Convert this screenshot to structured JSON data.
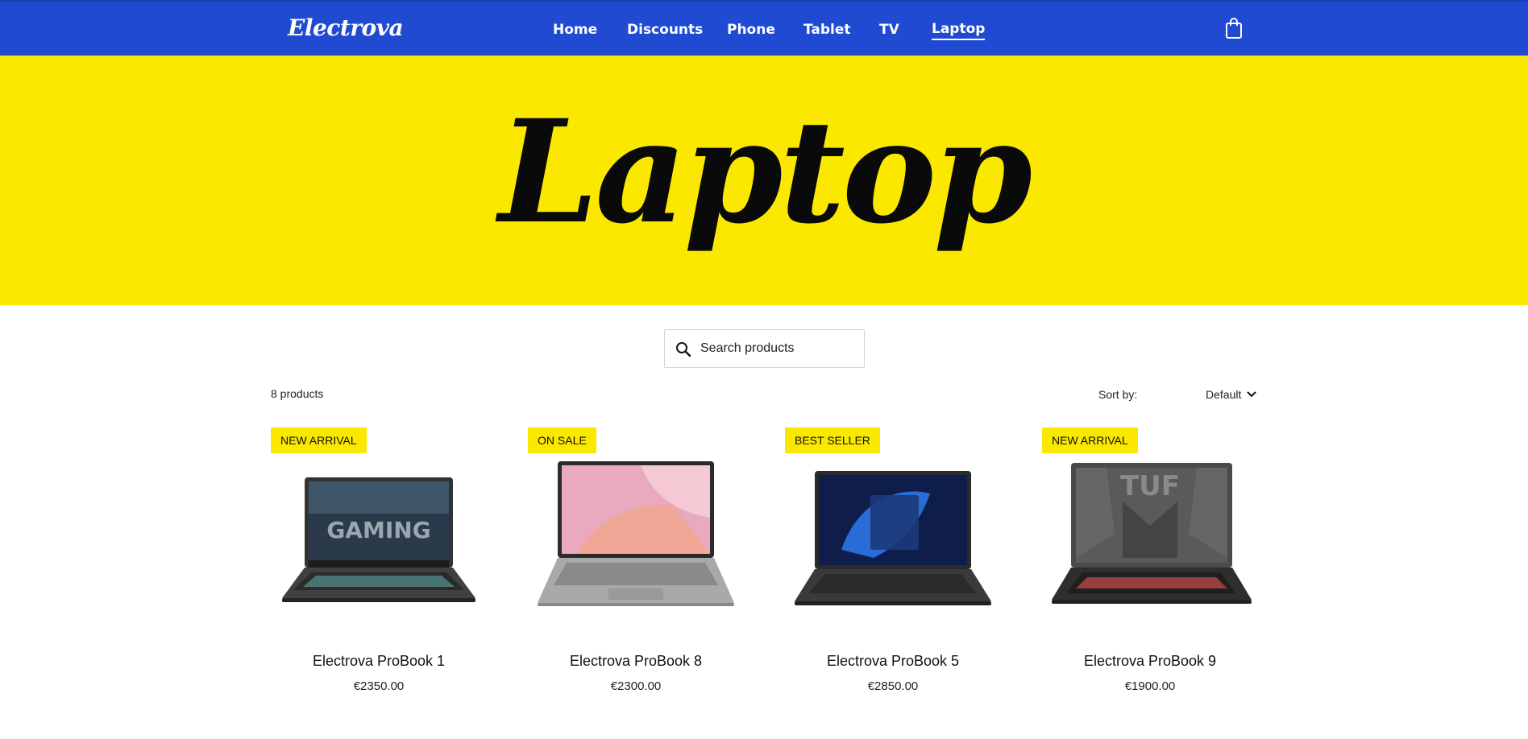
{
  "header": {
    "logo": "Electrova",
    "nav": [
      {
        "label": "Home"
      },
      {
        "label": "Discounts"
      },
      {
        "label": "Phone"
      },
      {
        "label": "Tablet"
      },
      {
        "label": "TV"
      },
      {
        "label": "Laptop",
        "active": true
      }
    ],
    "cart_icon": "shopping-bag-icon"
  },
  "hero": {
    "title": "Laptop",
    "background": "#fbe800"
  },
  "search": {
    "placeholder": "Search products",
    "icon": "search-icon"
  },
  "toolbar": {
    "product_count": "8 products",
    "sort_label": "Sort by:",
    "sort_value": "Default",
    "sort_icon": "chevron-down-icon"
  },
  "products": [
    {
      "badge": "NEW ARRIVAL",
      "name": "Electrova ProBook 1",
      "price": "€2350.00"
    },
    {
      "badge": "ON SALE",
      "name": "Electrova ProBook 8",
      "price": "€2300.00"
    },
    {
      "badge": "BEST SELLER",
      "name": "Electrova ProBook 5",
      "price": "€2850.00"
    },
    {
      "badge": "NEW ARRIVAL",
      "name": "Electrova ProBook 9",
      "price": "€1900.00"
    }
  ],
  "colors": {
    "nav_bg": "#1f4ad1",
    "accent": "#fbe800"
  }
}
